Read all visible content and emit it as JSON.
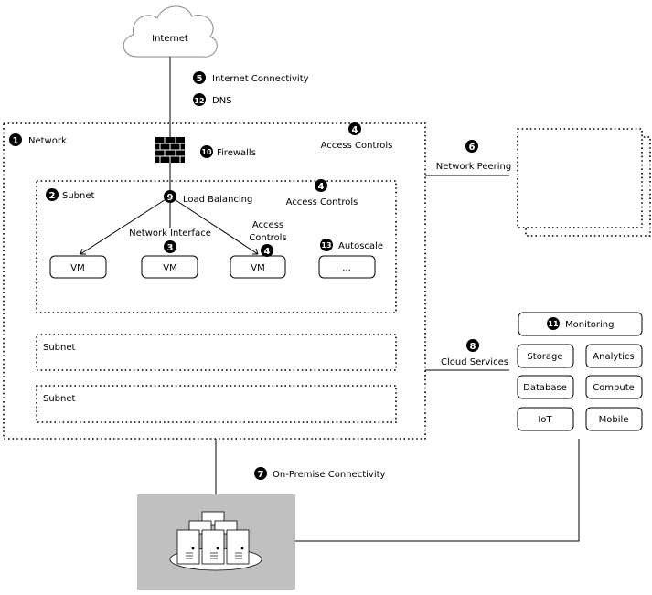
{
  "internet": "Internet",
  "labels": {
    "internet_connectivity": {
      "num": "5",
      "text": "Internet Connectivity"
    },
    "dns": {
      "num": "12",
      "text": "DNS"
    },
    "network": {
      "num": "1",
      "text": "Network"
    },
    "firewalls": {
      "num": "10",
      "text": "Firewalls"
    },
    "network_access": {
      "num": "4",
      "text": "Access Controls"
    },
    "subnet": {
      "num": "2",
      "text": "Subnet"
    },
    "load_balancing": {
      "num": "9",
      "text": "Load Balancing"
    },
    "subnet_access": {
      "num": "4",
      "text": "Access Controls"
    },
    "network_interface": {
      "num": "3",
      "text": "Network Interface"
    },
    "vm_access": {
      "num": "4",
      "line1": "Access",
      "line2": "Controls"
    },
    "autoscale": {
      "num": "13",
      "text": "Autoscale"
    },
    "network_peering": {
      "num": "6",
      "text": "Network Peering"
    },
    "cloud_services": {
      "num": "8",
      "text": "Cloud Services"
    },
    "monitoring": {
      "num": "11",
      "text": "Monitoring"
    },
    "on_premise": {
      "num": "7",
      "text": "On-Premise Connectivity"
    }
  },
  "vms": [
    "VM",
    "VM",
    "VM",
    "..."
  ],
  "other_subnets": [
    "Subnet",
    "Subnet"
  ],
  "services": [
    "Storage",
    "Analytics",
    "Database",
    "Compute",
    "IoT",
    "Mobile"
  ],
  "colors": {
    "on_premise_bg": "#c0c0c0"
  }
}
